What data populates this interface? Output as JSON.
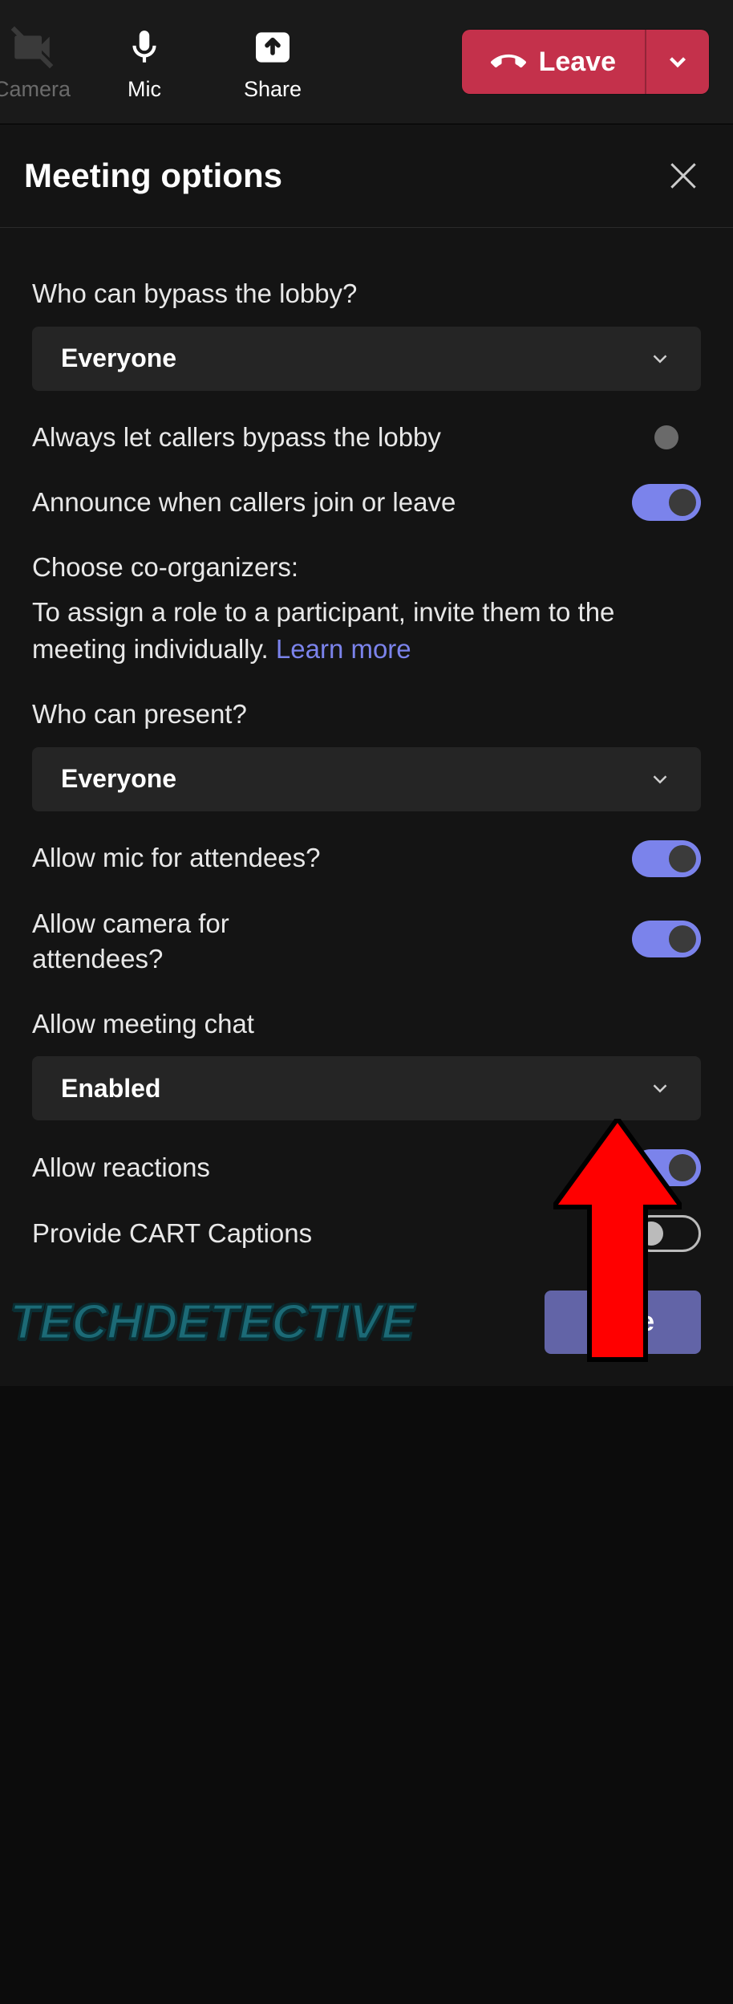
{
  "toolbar": {
    "camera_label": "Camera",
    "mic_label": "Mic",
    "share_label": "Share",
    "leave_label": "Leave"
  },
  "panel": {
    "title": "Meeting options"
  },
  "options": {
    "bypass_lobby_label": "Who can bypass the lobby?",
    "bypass_lobby_value": "Everyone",
    "always_callers_bypass_label": "Always let callers bypass the lobby",
    "announce_callers_label": "Announce when callers join or leave",
    "co_organizers_heading": "Choose co-organizers:",
    "co_organizers_sub_before": "To assign a role to a participant, invite them to the meeting individually. ",
    "learn_more": "Learn more",
    "who_can_present_label": "Who can present?",
    "who_can_present_value": "Everyone",
    "allow_mic_label": "Allow mic for attendees?",
    "allow_camera_label": "Allow camera for attendees?",
    "allow_chat_label": "Allow meeting chat",
    "allow_chat_value": "Enabled",
    "allow_reactions_label": "Allow reactions",
    "cart_captions_label": "Provide CART Captions"
  },
  "footer": {
    "watermark": "TECHDETECTIVE",
    "save_label": "Save"
  },
  "toggles": {
    "announce_callers": true,
    "allow_mic": true,
    "allow_camera": true,
    "allow_reactions": true,
    "cart_captions": false
  }
}
